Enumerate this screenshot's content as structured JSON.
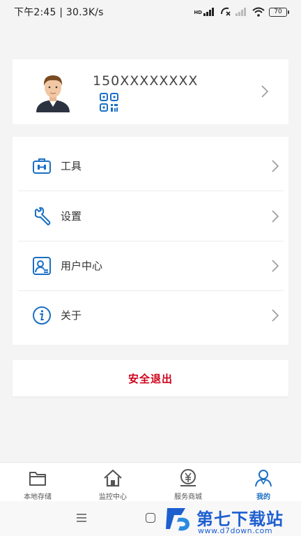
{
  "status_bar": {
    "time_speed": "下午2:45 | 30.3K/s",
    "hd_label": "HD",
    "battery": "70"
  },
  "profile": {
    "phone": "150XXXXXXXX",
    "avatar_icon": "user-avatar",
    "qr_icon": "qr-code-icon"
  },
  "menu": {
    "items": [
      {
        "label": "工具",
        "icon": "toolbox-icon"
      },
      {
        "label": "设置",
        "icon": "wrench-icon"
      },
      {
        "label": "用户中心",
        "icon": "user-card-icon"
      },
      {
        "label": "关于",
        "icon": "info-icon"
      }
    ]
  },
  "logout_label": "安全退出",
  "tabbar": {
    "tabs": [
      {
        "label": "本地存储",
        "icon": "folder-icon",
        "active": false
      },
      {
        "label": "监控中心",
        "icon": "home-icon",
        "active": false
      },
      {
        "label": "服务商城",
        "icon": "yuan-store-icon",
        "active": false
      },
      {
        "label": "我的",
        "icon": "user-icon",
        "active": true
      }
    ]
  },
  "watermark": {
    "title": "第七下载站",
    "url": "www.d7down.com"
  },
  "colors": {
    "accent": "#1a6fc4",
    "logout": "#d0021b",
    "background": "#f4f4f4"
  }
}
